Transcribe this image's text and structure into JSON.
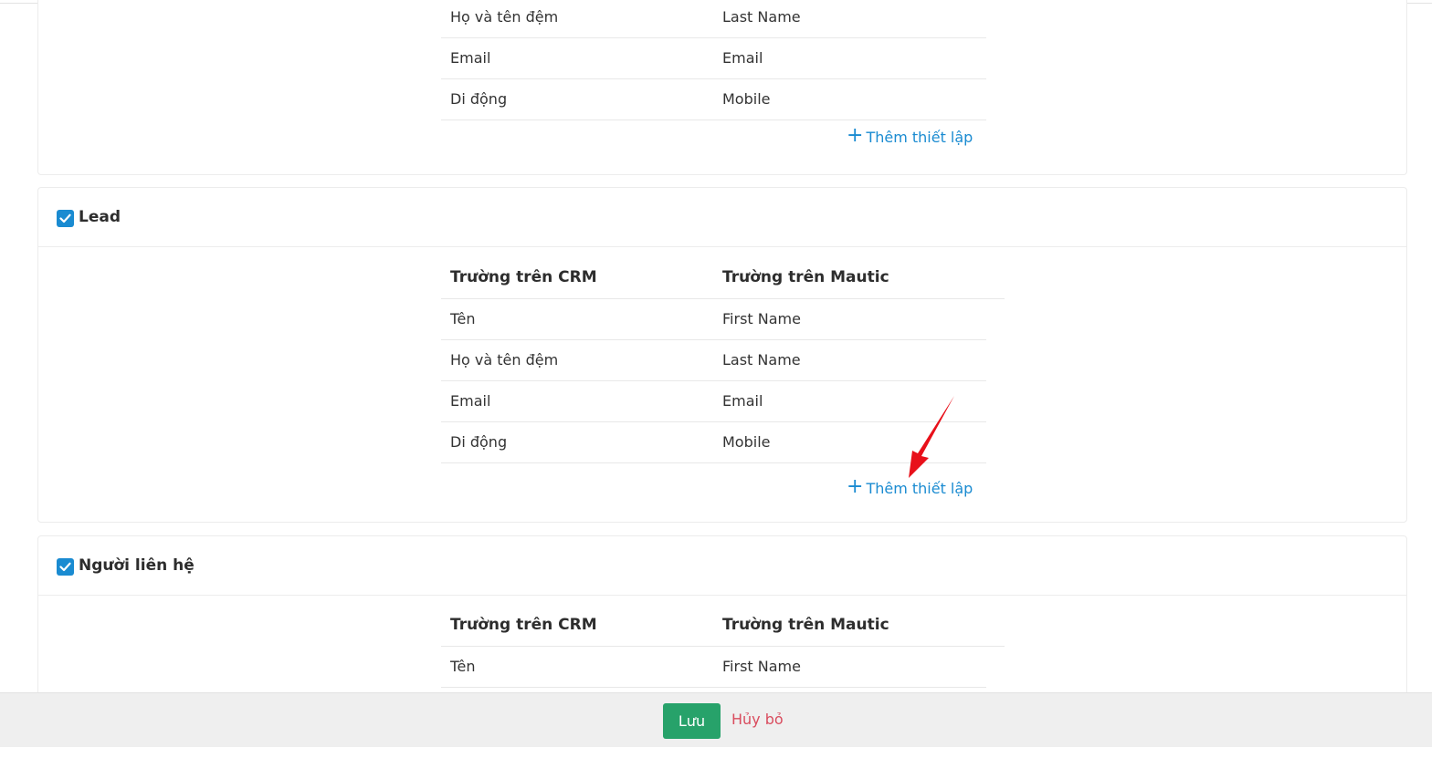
{
  "header_cols": {
    "crm": "Trường trên CRM",
    "mautic": "Trường trên Mautic"
  },
  "prev_section": {
    "rows": [
      {
        "crm": "Họ và tên đệm",
        "mautic": "Last Name"
      },
      {
        "crm": "Email",
        "mautic": "Email"
      },
      {
        "crm": "Di động",
        "mautic": "Mobile"
      }
    ],
    "add_label": "Thêm thiết lập"
  },
  "lead_section": {
    "title": "Lead",
    "checked": true,
    "rows": [
      {
        "crm": "Tên",
        "mautic": "First Name"
      },
      {
        "crm": "Họ và tên đệm",
        "mautic": "Last Name"
      },
      {
        "crm": "Email",
        "mautic": "Email"
      },
      {
        "crm": "Di động",
        "mautic": "Mobile"
      }
    ],
    "add_label": "Thêm thiết lập"
  },
  "contact_section": {
    "title": "Người liên hệ",
    "checked": true,
    "rows": [
      {
        "crm": "Tên",
        "mautic": "First Name"
      }
    ]
  },
  "footer": {
    "save_label": "Lưu",
    "cancel_label": "Hủy bỏ"
  },
  "colors": {
    "accent": "#1a8bd1",
    "save": "#27a26a",
    "cancel": "#d94c5e",
    "arrow": "#e8101a"
  }
}
